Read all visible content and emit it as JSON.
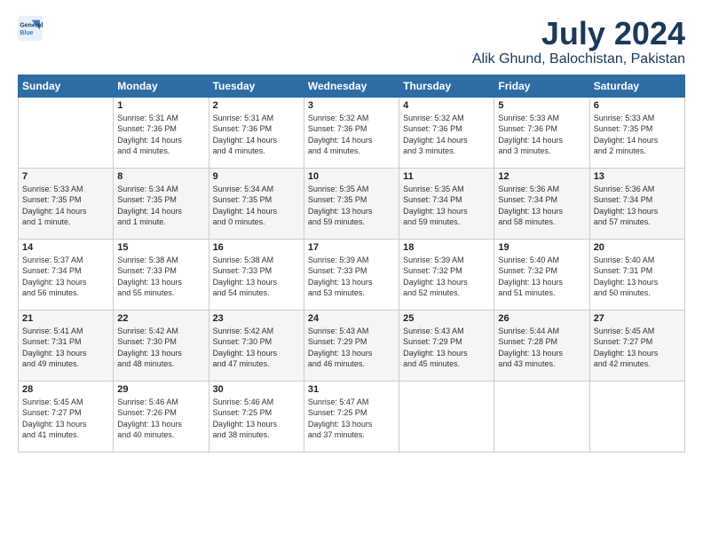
{
  "logo": {
    "line1": "General",
    "line2": "Blue"
  },
  "title": "July 2024",
  "location": "Alik Ghund, Balochistan, Pakistan",
  "days_header": [
    "Sunday",
    "Monday",
    "Tuesday",
    "Wednesday",
    "Thursday",
    "Friday",
    "Saturday"
  ],
  "weeks": [
    [
      {
        "day": "",
        "content": ""
      },
      {
        "day": "1",
        "content": "Sunrise: 5:31 AM\nSunset: 7:36 PM\nDaylight: 14 hours\nand 4 minutes."
      },
      {
        "day": "2",
        "content": "Sunrise: 5:31 AM\nSunset: 7:36 PM\nDaylight: 14 hours\nand 4 minutes."
      },
      {
        "day": "3",
        "content": "Sunrise: 5:32 AM\nSunset: 7:36 PM\nDaylight: 14 hours\nand 4 minutes."
      },
      {
        "day": "4",
        "content": "Sunrise: 5:32 AM\nSunset: 7:36 PM\nDaylight: 14 hours\nand 3 minutes."
      },
      {
        "day": "5",
        "content": "Sunrise: 5:33 AM\nSunset: 7:36 PM\nDaylight: 14 hours\nand 3 minutes."
      },
      {
        "day": "6",
        "content": "Sunrise: 5:33 AM\nSunset: 7:35 PM\nDaylight: 14 hours\nand 2 minutes."
      }
    ],
    [
      {
        "day": "7",
        "content": "Sunrise: 5:33 AM\nSunset: 7:35 PM\nDaylight: 14 hours\nand 1 minute."
      },
      {
        "day": "8",
        "content": "Sunrise: 5:34 AM\nSunset: 7:35 PM\nDaylight: 14 hours\nand 1 minute."
      },
      {
        "day": "9",
        "content": "Sunrise: 5:34 AM\nSunset: 7:35 PM\nDaylight: 14 hours\nand 0 minutes."
      },
      {
        "day": "10",
        "content": "Sunrise: 5:35 AM\nSunset: 7:35 PM\nDaylight: 13 hours\nand 59 minutes."
      },
      {
        "day": "11",
        "content": "Sunrise: 5:35 AM\nSunset: 7:34 PM\nDaylight: 13 hours\nand 59 minutes."
      },
      {
        "day": "12",
        "content": "Sunrise: 5:36 AM\nSunset: 7:34 PM\nDaylight: 13 hours\nand 58 minutes."
      },
      {
        "day": "13",
        "content": "Sunrise: 5:36 AM\nSunset: 7:34 PM\nDaylight: 13 hours\nand 57 minutes."
      }
    ],
    [
      {
        "day": "14",
        "content": "Sunrise: 5:37 AM\nSunset: 7:34 PM\nDaylight: 13 hours\nand 56 minutes."
      },
      {
        "day": "15",
        "content": "Sunrise: 5:38 AM\nSunset: 7:33 PM\nDaylight: 13 hours\nand 55 minutes."
      },
      {
        "day": "16",
        "content": "Sunrise: 5:38 AM\nSunset: 7:33 PM\nDaylight: 13 hours\nand 54 minutes."
      },
      {
        "day": "17",
        "content": "Sunrise: 5:39 AM\nSunset: 7:33 PM\nDaylight: 13 hours\nand 53 minutes."
      },
      {
        "day": "18",
        "content": "Sunrise: 5:39 AM\nSunset: 7:32 PM\nDaylight: 13 hours\nand 52 minutes."
      },
      {
        "day": "19",
        "content": "Sunrise: 5:40 AM\nSunset: 7:32 PM\nDaylight: 13 hours\nand 51 minutes."
      },
      {
        "day": "20",
        "content": "Sunrise: 5:40 AM\nSunset: 7:31 PM\nDaylight: 13 hours\nand 50 minutes."
      }
    ],
    [
      {
        "day": "21",
        "content": "Sunrise: 5:41 AM\nSunset: 7:31 PM\nDaylight: 13 hours\nand 49 minutes."
      },
      {
        "day": "22",
        "content": "Sunrise: 5:42 AM\nSunset: 7:30 PM\nDaylight: 13 hours\nand 48 minutes."
      },
      {
        "day": "23",
        "content": "Sunrise: 5:42 AM\nSunset: 7:30 PM\nDaylight: 13 hours\nand 47 minutes."
      },
      {
        "day": "24",
        "content": "Sunrise: 5:43 AM\nSunset: 7:29 PM\nDaylight: 13 hours\nand 46 minutes."
      },
      {
        "day": "25",
        "content": "Sunrise: 5:43 AM\nSunset: 7:29 PM\nDaylight: 13 hours\nand 45 minutes."
      },
      {
        "day": "26",
        "content": "Sunrise: 5:44 AM\nSunset: 7:28 PM\nDaylight: 13 hours\nand 43 minutes."
      },
      {
        "day": "27",
        "content": "Sunrise: 5:45 AM\nSunset: 7:27 PM\nDaylight: 13 hours\nand 42 minutes."
      }
    ],
    [
      {
        "day": "28",
        "content": "Sunrise: 5:45 AM\nSunset: 7:27 PM\nDaylight: 13 hours\nand 41 minutes."
      },
      {
        "day": "29",
        "content": "Sunrise: 5:46 AM\nSunset: 7:26 PM\nDaylight: 13 hours\nand 40 minutes."
      },
      {
        "day": "30",
        "content": "Sunrise: 5:46 AM\nSunset: 7:25 PM\nDaylight: 13 hours\nand 38 minutes."
      },
      {
        "day": "31",
        "content": "Sunrise: 5:47 AM\nSunset: 7:25 PM\nDaylight: 13 hours\nand 37 minutes."
      },
      {
        "day": "",
        "content": ""
      },
      {
        "day": "",
        "content": ""
      },
      {
        "day": "",
        "content": ""
      }
    ]
  ]
}
